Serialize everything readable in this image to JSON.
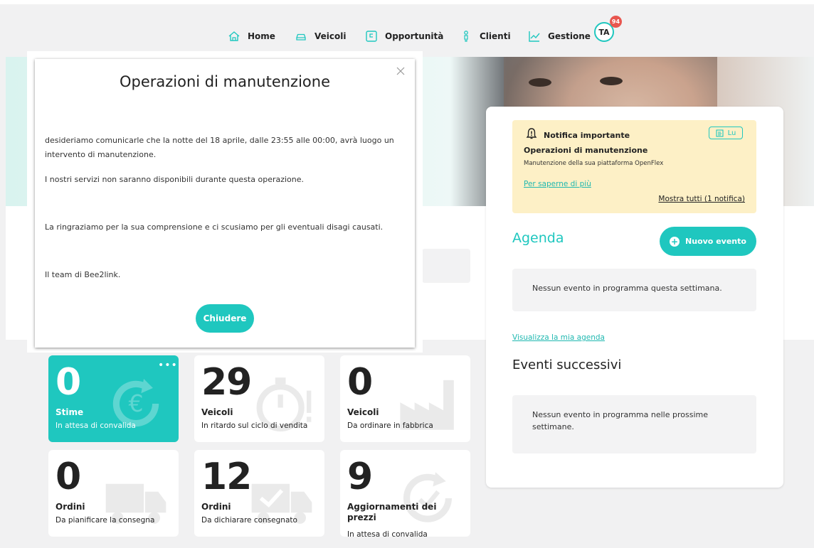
{
  "nav": {
    "items": [
      {
        "label": "Home",
        "icon": "home-icon"
      },
      {
        "label": "Veicoli",
        "icon": "car-icon"
      },
      {
        "label": "Opportunità",
        "icon": "opportunity-icon"
      },
      {
        "label": "Clienti",
        "icon": "client-icon"
      },
      {
        "label": "Gestione",
        "icon": "chart-icon"
      }
    ],
    "avatar_initials": "TA",
    "avatar_badge": "94"
  },
  "modal": {
    "title": "Operazioni di manutenzione",
    "paragraphs": [
      "desideriamo comunicarle che la notte del 18 aprile, dalle 23:55 alle 00:00, avrà luogo un intervento di manutenzione.",
      "I nostri servizi non saranno disponibili durante questa operazione.",
      "La ringraziamo per la sua comprensione e ci scusiamo per gli eventuali disagi causati.",
      "Il team di Bee2link."
    ],
    "close_button": "Chiudere"
  },
  "notification": {
    "heading": "Notifica importante",
    "read_label": "Lu",
    "title": "Operazioni di manutenzione",
    "description": "Manutenzione della sua piattaforma OpenFlex",
    "more_link": "Per saperne di più",
    "show_all": "Mostra tutti (1 notifica)"
  },
  "agenda": {
    "title": "Agenda",
    "new_event_button": "Nuovo evento",
    "empty_week": "Nessun evento in programma questa settimana.",
    "view_link": "Visualizza la mia agenda",
    "next_title": "Eventi successivi",
    "empty_next": "Nessun evento in programma nelle prossime settimane."
  },
  "tiles": [
    {
      "value": "0",
      "label": "Stime",
      "sub": "In attesa di convalida",
      "icon": "euro-refresh-icon",
      "active": true
    },
    {
      "value": "29",
      "label": "Veicoli",
      "sub": "In ritardo sul ciclo di vendita",
      "icon": "stopwatch-icon",
      "active": false
    },
    {
      "value": "0",
      "label": "Veicoli",
      "sub": "Da ordinare in fabbrica",
      "icon": "factory-icon",
      "active": false
    },
    {
      "value": "0",
      "label": "Ordini",
      "sub": "Da pianificare la consegna",
      "icon": "truck-icon",
      "active": false
    },
    {
      "value": "12",
      "label": "Ordini",
      "sub": "Da dichiarare consegnato",
      "icon": "truck-check-icon",
      "active": false
    },
    {
      "value": "9",
      "label": "Aggiornamenti dei prezzi",
      "sub": "In attesa di convalida",
      "icon": "price-refresh-icon",
      "active": false
    }
  ],
  "colors": {
    "accent": "#1fc7bf",
    "notification_bg": "#fdf0c6",
    "badge": "#e8564f"
  }
}
